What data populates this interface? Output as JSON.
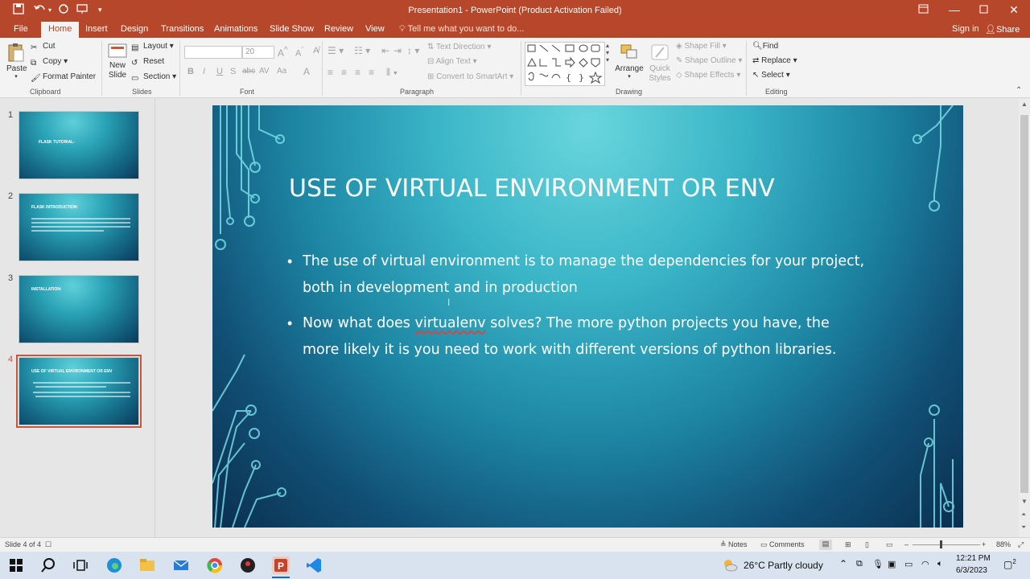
{
  "window": {
    "title": "Presentation1 - PowerPoint (Product Activation Failed)"
  },
  "tabs": [
    "File",
    "Home",
    "Insert",
    "Design",
    "Transitions",
    "Animations",
    "Slide Show",
    "Review",
    "View"
  ],
  "active_tab": "Home",
  "tell_me": "Tell me what you want to do...",
  "sign_in": "Sign in",
  "share": "Share",
  "ribbon": {
    "clipboard": {
      "paste": "Paste",
      "cut": "Cut",
      "copy": "Copy",
      "format_painter": "Format Painter",
      "label": "Clipboard"
    },
    "slides": {
      "new_slide": "New Slide",
      "layout": "Layout",
      "reset": "Reset",
      "section": "Section",
      "label": "Slides"
    },
    "font": {
      "font_size": "20",
      "label": "Font",
      "buttons": [
        "B",
        "I",
        "U",
        "S",
        "abc",
        "AV",
        "Aa",
        "A"
      ]
    },
    "paragraph": {
      "text_direction": "Text Direction",
      "align_text": "Align Text",
      "convert_smartart": "Convert to SmartArt",
      "label": "Paragraph"
    },
    "drawing": {
      "arrange": "Arrange",
      "quick_styles": "Quick Styles",
      "shape_fill": "Shape Fill",
      "shape_outline": "Shape Outline",
      "shape_effects": "Shape Effects",
      "label": "Drawing"
    },
    "editing": {
      "find": "Find",
      "replace": "Replace",
      "select": "Select",
      "label": "Editing"
    }
  },
  "thumbnails": [
    {
      "num": "1",
      "title": "FLASK TUTORIAL:"
    },
    {
      "num": "2",
      "title": "FLASK INTRODUCTION:"
    },
    {
      "num": "3",
      "title": "INSTALLATION:"
    },
    {
      "num": "4",
      "title": "USE OF VIRTUAL ENVIRONMENT OR ENV"
    }
  ],
  "selected_slide": 4,
  "slide": {
    "title": "USE OF VIRTUAL ENVIRONMENT OR ENV",
    "bullets": [
      {
        "line1": "The use of virtual environment is to manage the dependencies for your project,",
        "line2": "both in development and in production"
      },
      {
        "line1_pre": "Now what does ",
        "line1_sq": "virtualenv",
        "line1_post": " solves? The more python projects you have, the",
        "line2": "more likely it is you need to work with different versions of python libraries."
      }
    ]
  },
  "status": {
    "slide_of": "Slide 4 of 4",
    "notes": "Notes",
    "comments": "Comments",
    "zoom": "88%"
  },
  "taskbar": {
    "weather": "26°C  Partly cloudy",
    "time": "12:21 PM",
    "date": "6/3/2023",
    "notifications": "2"
  }
}
